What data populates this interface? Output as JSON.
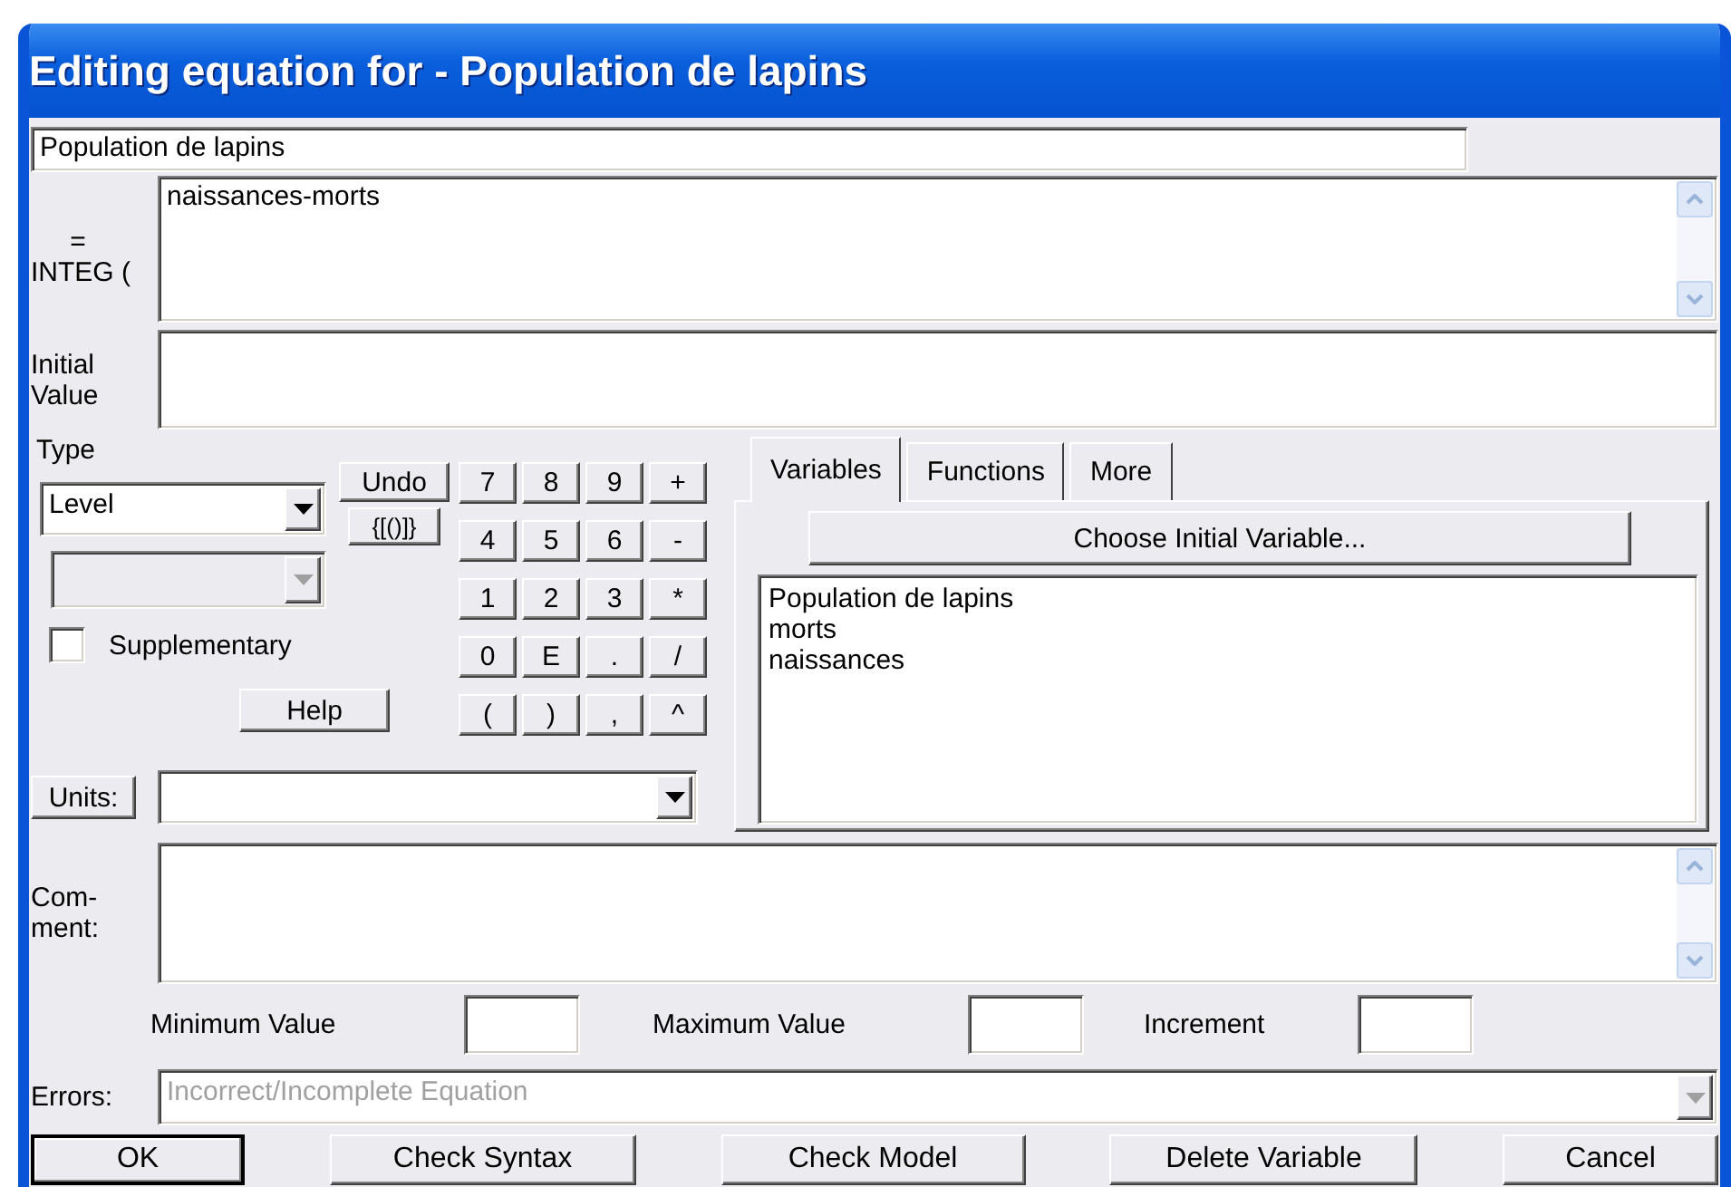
{
  "window": {
    "title": "Editing equation for - Population de lapins"
  },
  "variable_name": {
    "value": "Population de lapins"
  },
  "equation": {
    "label_lines": [
      "=",
      "INTEG ("
    ],
    "value": "naissances-morts"
  },
  "initial_value": {
    "label_lines": [
      "Initial",
      "Value"
    ]
  },
  "type": {
    "label": "Type",
    "value": "Level"
  },
  "subtype": {
    "disabled": true
  },
  "supplementary": {
    "label": "Supplementary",
    "checked": false
  },
  "undo_button": "Undo",
  "brackets_button": "{[()]}",
  "help_button": "Help",
  "keypad": [
    [
      "7",
      "8",
      "9",
      "+"
    ],
    [
      "4",
      "5",
      "6",
      "-"
    ],
    [
      "1",
      "2",
      "3",
      "*"
    ],
    [
      "0",
      "E",
      ".",
      "/"
    ],
    [
      "(",
      ")",
      ",",
      "^"
    ]
  ],
  "units": {
    "button": "Units:"
  },
  "tabs": [
    {
      "label": "Variables",
      "selected": true
    },
    {
      "label": "Functions",
      "selected": false
    },
    {
      "label": "More",
      "selected": false
    }
  ],
  "choose_button": "Choose Initial Variable...",
  "variables": [
    "Population de lapins",
    "morts",
    "naissances"
  ],
  "comment": {
    "label_lines": [
      "Com-",
      "ment:"
    ]
  },
  "ranges": [
    {
      "label": "Minimum Value"
    },
    {
      "label": "Maximum Value"
    },
    {
      "label": "Increment"
    }
  ],
  "errors": {
    "label": "Errors:",
    "value": "Incorrect/Incomplete Equation",
    "disabled": true
  },
  "buttons": [
    {
      "label": "OK",
      "default": true
    },
    {
      "label": "Check Syntax",
      "default": false
    },
    {
      "label": "Check Model",
      "default": false
    },
    {
      "label": "Delete Variable",
      "default": false
    },
    {
      "label": "Cancel",
      "default": false
    }
  ]
}
